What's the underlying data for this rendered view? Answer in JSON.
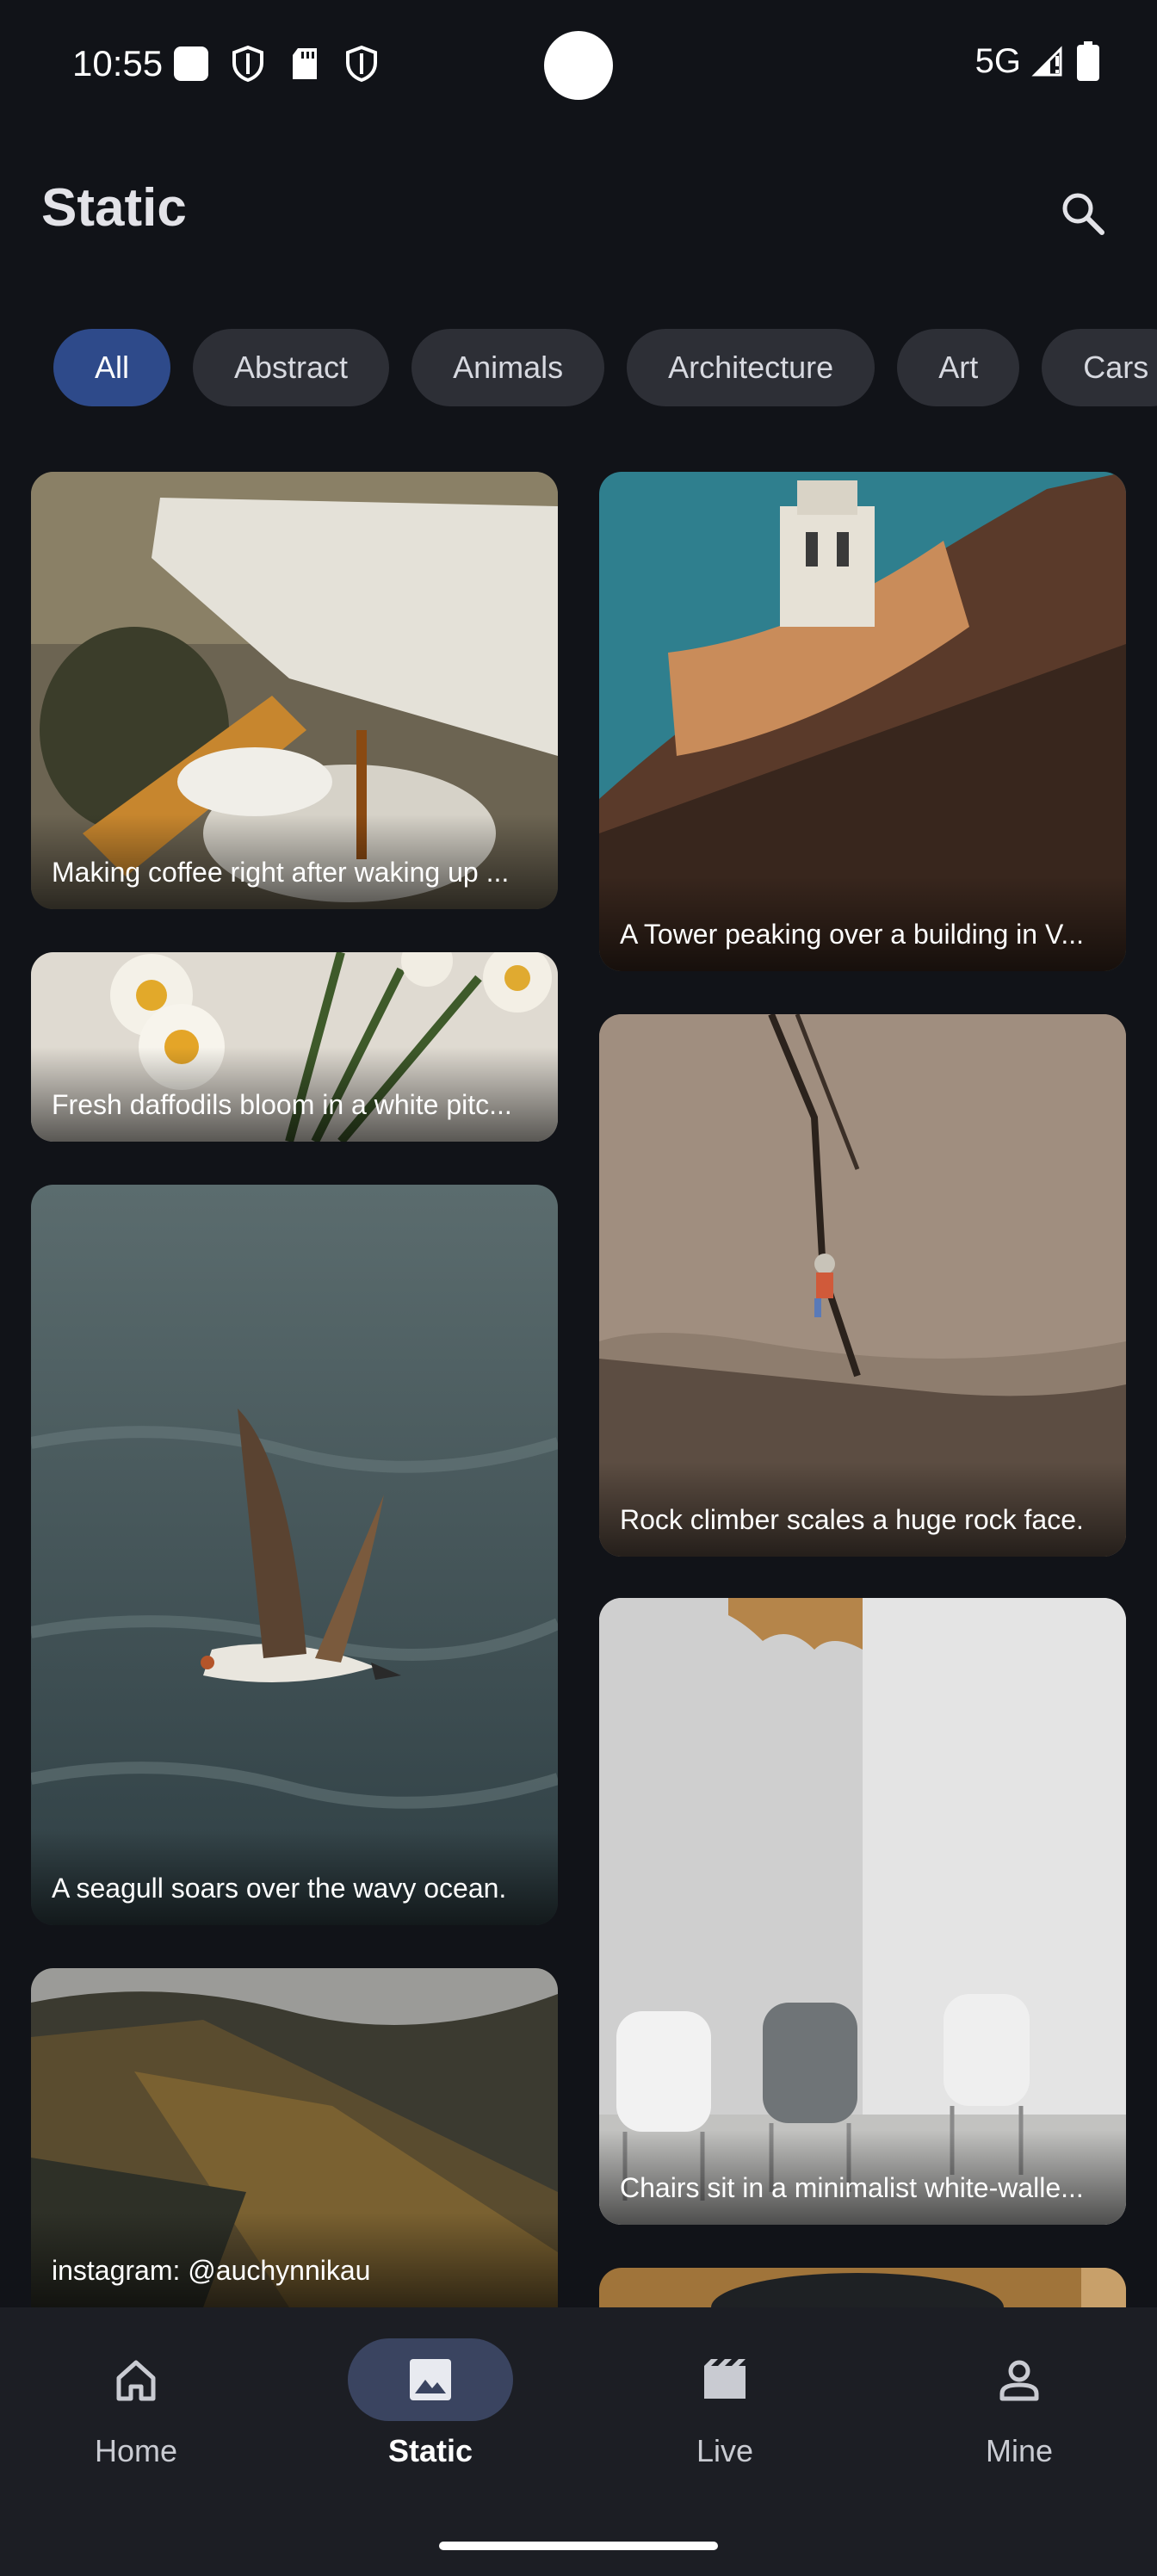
{
  "status_bar": {
    "time": "10:55",
    "network": "5G",
    "icons_left": [
      "square-icon",
      "shield-icon",
      "sd-card-icon",
      "shield-icon"
    ],
    "icons_right": [
      "signal-icon",
      "battery-icon"
    ]
  },
  "app_bar": {
    "title": "Static",
    "search_icon": "search-icon"
  },
  "filter_chips": [
    {
      "label": "All",
      "selected": true
    },
    {
      "label": "Abstract",
      "selected": false
    },
    {
      "label": "Animals",
      "selected": false
    },
    {
      "label": "Architecture",
      "selected": false
    },
    {
      "label": "Art",
      "selected": false
    },
    {
      "label": "Cars",
      "selected": false
    }
  ],
  "photos": [
    {
      "caption": "Making coffee right after waking up ...",
      "column": "left"
    },
    {
      "caption": "Fresh daffodils bloom in a white pitc...",
      "column": "left"
    },
    {
      "caption": "A seagull soars over the wavy ocean.",
      "column": "left"
    },
    {
      "caption": "instagram: @auchynnikau",
      "column": "left"
    },
    {
      "caption": "A Tower peaking over a building in V...",
      "column": "right"
    },
    {
      "caption": "Rock climber scales a huge rock face.",
      "column": "right"
    },
    {
      "caption": "Chairs sit in a minimalist white-walle...",
      "column": "right"
    },
    {
      "caption": "",
      "column": "right"
    }
  ],
  "bottom_nav": [
    {
      "label": "Home",
      "icon": "home-icon",
      "active": false
    },
    {
      "label": "Static",
      "icon": "image-icon",
      "active": true
    },
    {
      "label": "Live",
      "icon": "movie-icon",
      "active": false
    },
    {
      "label": "Mine",
      "icon": "person-icon",
      "active": false
    }
  ],
  "colors": {
    "background": "#111318",
    "chip_selected": "#2e4a8a",
    "chip": "#2d2f36",
    "nav_bar": "#1c1e24",
    "nav_active_pill": "#3a4460"
  }
}
